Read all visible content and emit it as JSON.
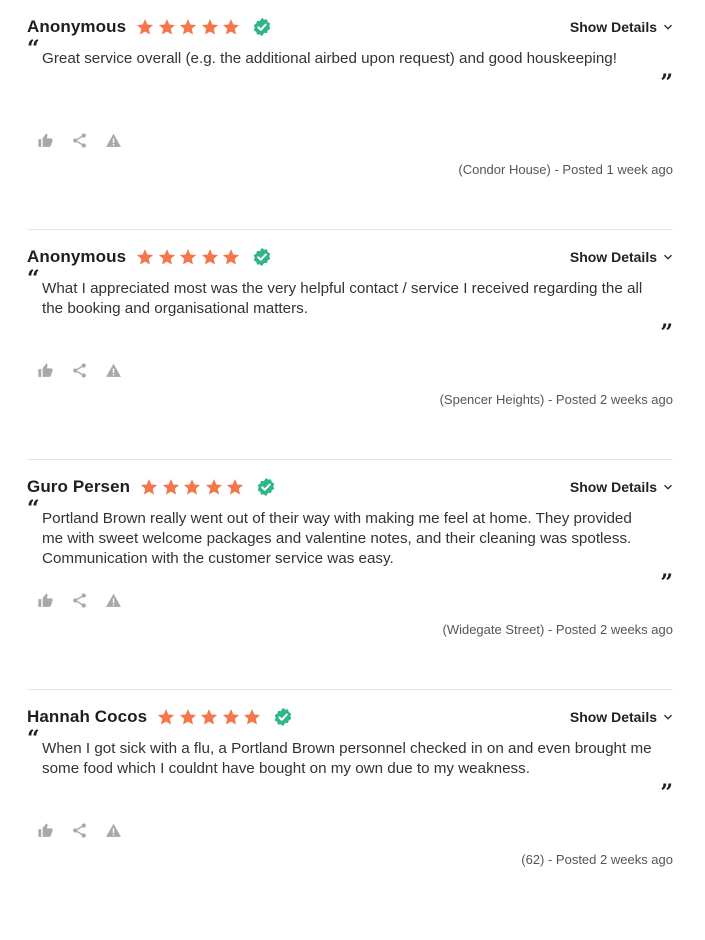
{
  "colors": {
    "star": "#f4764b",
    "verified": "#2fb58a",
    "icon_gray": "#a8a8a8",
    "divider": "#e6e6e6"
  },
  "icons": {
    "star": "star-icon",
    "verified": "verified-badge-icon",
    "chevron": "chevron-down-icon",
    "like": "thumbs-up-icon",
    "share": "share-icon",
    "report": "warning-icon"
  },
  "show_details_label": "Show Details",
  "quote_open": "“",
  "quote_close": "”",
  "reviews": [
    {
      "name": "Anonymous",
      "rating": 5,
      "verified": true,
      "text": "Great service overall (e.g. the additional airbed upon request) and good houskeeping!",
      "posted": "(Condor House) - Posted 1 week ago"
    },
    {
      "name": "Anonymous",
      "rating": 5,
      "verified": true,
      "text": "What I appreciated most was the very helpful contact / service I received regarding the all the booking and organisational matters.",
      "posted": "(Spencer Heights) - Posted 2 weeks ago"
    },
    {
      "name": "Guro Persen",
      "rating": 5,
      "verified": true,
      "text": "Portland Brown really went out of their way with making me feel at home. They provided me with sweet welcome packages and valentine notes, and their cleaning was spotless. Communication with the customer service was easy.",
      "posted": "(Widegate Street) - Posted 2 weeks ago"
    },
    {
      "name": "Hannah Cocos",
      "rating": 5,
      "verified": true,
      "text": "When I got sick with a flu, a Portland Brown personnel checked in on and even brought me some food which I couldnt have bought on my own due to my weakness.",
      "posted": "(62) - Posted 2 weeks ago"
    }
  ]
}
